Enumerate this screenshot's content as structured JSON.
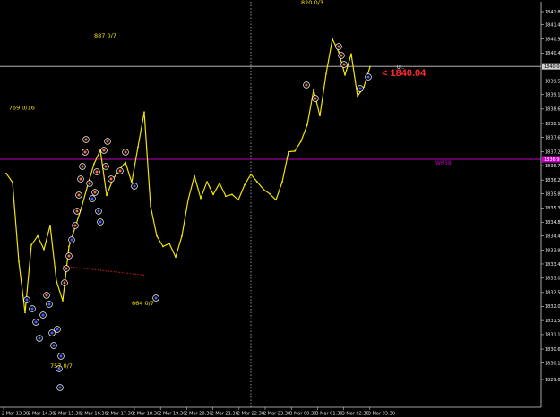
{
  "chart_data": {
    "type": "line",
    "ylim": [
      1829.63,
      1841.86
    ],
    "y_ticks": [
      "1841.86",
      "1841.43",
      "1840.95",
      "1840.48",
      "1839.55",
      "1839.10",
      "1838.62",
      "1838.14",
      "1837.68",
      "1837.20",
      "1836.74",
      "1836.26",
      "1835.80",
      "1835.33",
      "1834.86",
      "1834.40",
      "1833.93",
      "1833.47",
      "1833.00",
      "1832.52",
      "1832.06",
      "1831.59",
      "1831.12",
      "1830.64",
      "1830.18",
      "1829.63"
    ],
    "x_ticks": [
      "2 Mar 13:30",
      "2 Mar 14:30",
      "2 Mar 15:30",
      "2 Mar 16:30",
      "2 Mar 17:30",
      "2 Mar 18:30",
      "2 Mar 19:30",
      "2 Mar 20:30",
      "2 Mar 21:30",
      "2 Mar 22:30",
      "2 Mar 23:30",
      "3 Mar 00:30",
      "3 Mar 01:30",
      "3 Mar 02:30",
      "3 Mar 03:30"
    ],
    "series": [
      {
        "color": "#f2e500",
        "x": [
          0,
          1,
          2,
          3,
          4,
          5,
          6,
          7,
          8,
          9,
          10,
          11,
          12,
          13,
          14,
          15,
          16,
          17,
          18,
          19,
          20,
          21,
          22,
          23,
          24,
          25,
          26,
          27,
          28,
          29,
          30,
          31,
          32,
          33,
          34,
          35,
          36,
          37,
          38,
          39,
          40,
          41,
          42,
          43,
          44,
          45,
          46,
          47,
          48,
          49,
          50,
          51,
          52,
          53,
          54,
          55,
          56,
          57,
          58
        ],
        "values": [
          1836.48,
          1836.18,
          1833.55,
          1831.85,
          1834.1,
          1834.4,
          1833.95,
          1834.75,
          1832.9,
          1832.25,
          1834.05,
          1834.7,
          1835.35,
          1836.1,
          1836.8,
          1837.25,
          1835.75,
          1836.28,
          1836.6,
          1836.85,
          1836.18,
          1837.36,
          1838.52,
          1835.4,
          1834.4,
          1834.05,
          1834.15,
          1833.7,
          1834.4,
          1835.6,
          1836.4,
          1835.65,
          1836.2,
          1835.78,
          1836.15,
          1835.72,
          1835.78,
          1835.6,
          1836.1,
          1836.45,
          1836.2,
          1835.95,
          1835.8,
          1835.6,
          1836.2,
          1837.2,
          1837.22,
          1837.55,
          1838.1,
          1839.25,
          1838.4,
          1839.8,
          1840.95,
          1840.52,
          1839.75,
          1840.45,
          1839.05,
          1839.35,
          1840.03
        ]
      }
    ],
    "horizontal_lines": [
      {
        "value": 1840.04,
        "color": "#cfcfcf",
        "price_label": "1840.04"
      },
      {
        "value": 1836.95,
        "color": "#c400c4",
        "price_label": "1836.95",
        "tag": "WR38"
      }
    ],
    "vertical_lines": [
      {
        "x": 39,
        "color": "#b8b8b8",
        "style": "dotted"
      }
    ],
    "segments": [
      {
        "x1": 9,
        "y1": 1833.4,
        "x2": 22,
        "y2": 1833.1,
        "color": "#d01a1a",
        "style": "dotted"
      }
    ],
    "annotations": [
      {
        "text": "887 0/7",
        "x": 14,
        "y": 1841.0,
        "color": "#f2e500"
      },
      {
        "text": "769 0/16",
        "x": 0.4,
        "y": 1838.6,
        "color": "#f2e500"
      },
      {
        "text": "664 0/7",
        "x": 20,
        "y": 1832.1,
        "color": "#f2e500"
      },
      {
        "text": "757 0/7",
        "x": 7,
        "y": 1830.02,
        "color": "#f2e500"
      },
      {
        "text": "820 0/3",
        "x": 47,
        "y": 1842.1,
        "color": "#f2e500"
      }
    ],
    "price_callout": {
      "text": "< 1840.04",
      "color": "#ff2a2a",
      "tag": "U..."
    }
  }
}
